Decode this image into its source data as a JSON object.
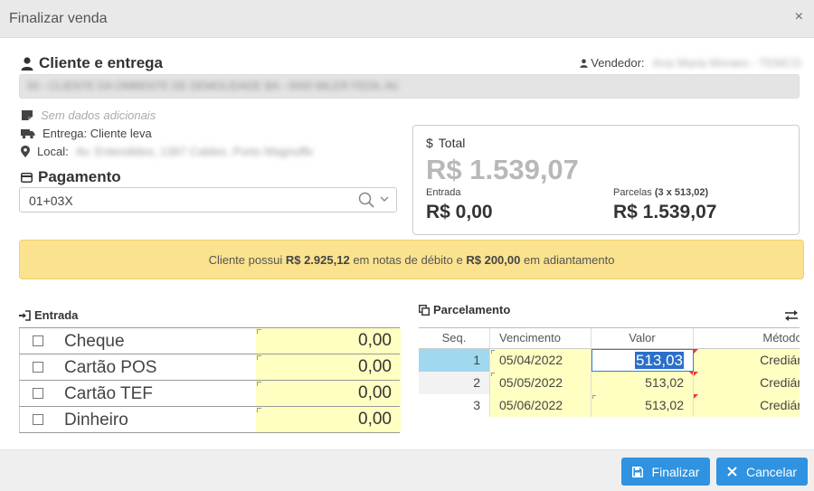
{
  "window": {
    "title": "Finalizar venda",
    "close_glyph": "×"
  },
  "cliente": {
    "heading": "Cliente e entrega",
    "vendedor_label": "Vendedor:",
    "vendedor_value": "Ana Maria Moraes - TEMCO",
    "client_value": "00 - CLIENTE DA OMBENTE DE DEMOLIDADE BA - 0000 MILER FEDIL AV.",
    "sem_dados": "Sem dados adicionais",
    "entrega": "Entrega: Cliente leva",
    "local_label": "Local:",
    "local_value": "Av. Entendidos, 1367 Caldes. Porto Magnoffe"
  },
  "pagamento": {
    "heading": "Pagamento",
    "value": "01+03X"
  },
  "totals": {
    "total_label": "Total",
    "total_value": "R$ 1.539,07",
    "entrada_label": "Entrada",
    "entrada_value": "R$ 0,00",
    "parcelas_label": "Parcelas",
    "parcelas_detail": "(3 x 513,02)",
    "parcelas_value": "R$ 1.539,07"
  },
  "notice": {
    "part1": "Cliente possui",
    "debit": "R$ 2.925,12",
    "part2": "em notas de débito e",
    "advance": "R$ 200,00",
    "part3": "em adiantamento"
  },
  "entrada": {
    "heading": "Entrada",
    "rows": [
      {
        "label": "Cheque",
        "value": "0,00"
      },
      {
        "label": "Cartão POS",
        "value": "0,00"
      },
      {
        "label": "Cartão TEF",
        "value": "0,00"
      },
      {
        "label": "Dinheiro",
        "value": "0,00"
      }
    ]
  },
  "parcelamento": {
    "heading": "Parcelamento",
    "columns": {
      "seq": "Seq.",
      "vencimento": "Vencimento",
      "valor": "Valor",
      "metodo": "Métodc"
    },
    "rows": [
      {
        "seq": "1",
        "vencimento": "05/04/2022",
        "valor": "513,03",
        "metodo": "Crediár"
      },
      {
        "seq": "2",
        "vencimento": "05/05/2022",
        "valor": "513,02",
        "metodo": "Crediár"
      },
      {
        "seq": "3",
        "vencimento": "05/06/2022",
        "valor": "513,02",
        "metodo": "Crediár"
      }
    ]
  },
  "footer": {
    "finalizar_label": "Finalizar",
    "cancelar_label": "Cancelar"
  }
}
